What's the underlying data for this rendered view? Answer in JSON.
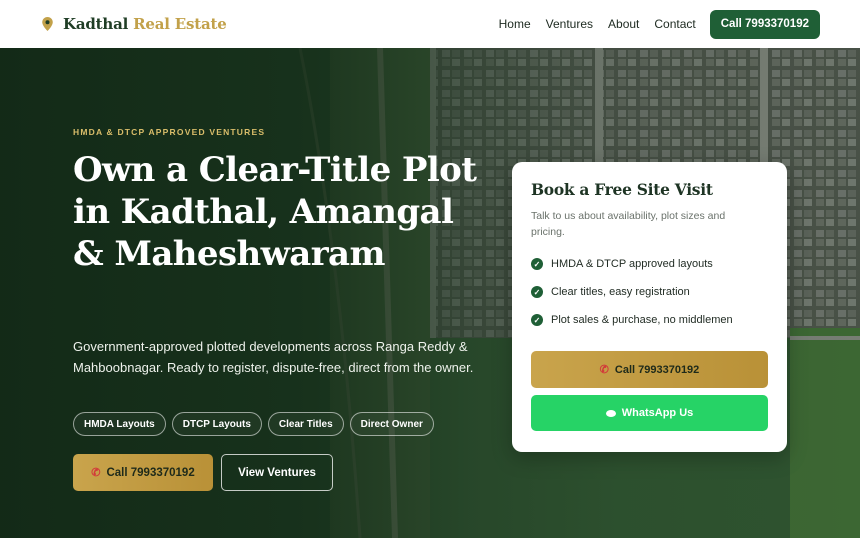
{
  "brand": {
    "name_part1": "Kadthal",
    "name_part2": "Real Estate"
  },
  "nav": {
    "links": [
      "Home",
      "Ventures",
      "About",
      "Contact"
    ],
    "cta": "Call 7993370192"
  },
  "hero": {
    "eyebrow": "HMDA & DTCP APPROVED VENTURES",
    "headline": "Own a Clear-Title Plot in Kadthal, Amangal & Maheshwaram",
    "subtitle": "Government-approved plotted developments across Ranga Reddy & Mahboobnagar. Ready to register, dispute-free, direct from the owner.",
    "chips": [
      "HMDA Layouts",
      "DTCP Layouts",
      "Clear Titles",
      "Direct Owner"
    ],
    "primary_button": "Call 7993370192",
    "secondary_button": "View Ventures"
  },
  "card": {
    "title": "Book a Free Site Visit",
    "subtitle": "Talk to us about availability, plot sizes and pricing.",
    "features": [
      "HMDA & DTCP approved layouts",
      "Clear titles, easy registration",
      "Plot sales & purchase, no middlemen"
    ],
    "call_button": "Call 7993370192",
    "whatsapp_button": "WhatsApp Us"
  },
  "colors": {
    "brand_green": "#1f5f36",
    "gold": "#c2a14a",
    "whatsapp": "#26d366"
  },
  "icons": [
    "map-pin-icon",
    "phone-icon",
    "check-icon",
    "whatsapp-icon"
  ]
}
